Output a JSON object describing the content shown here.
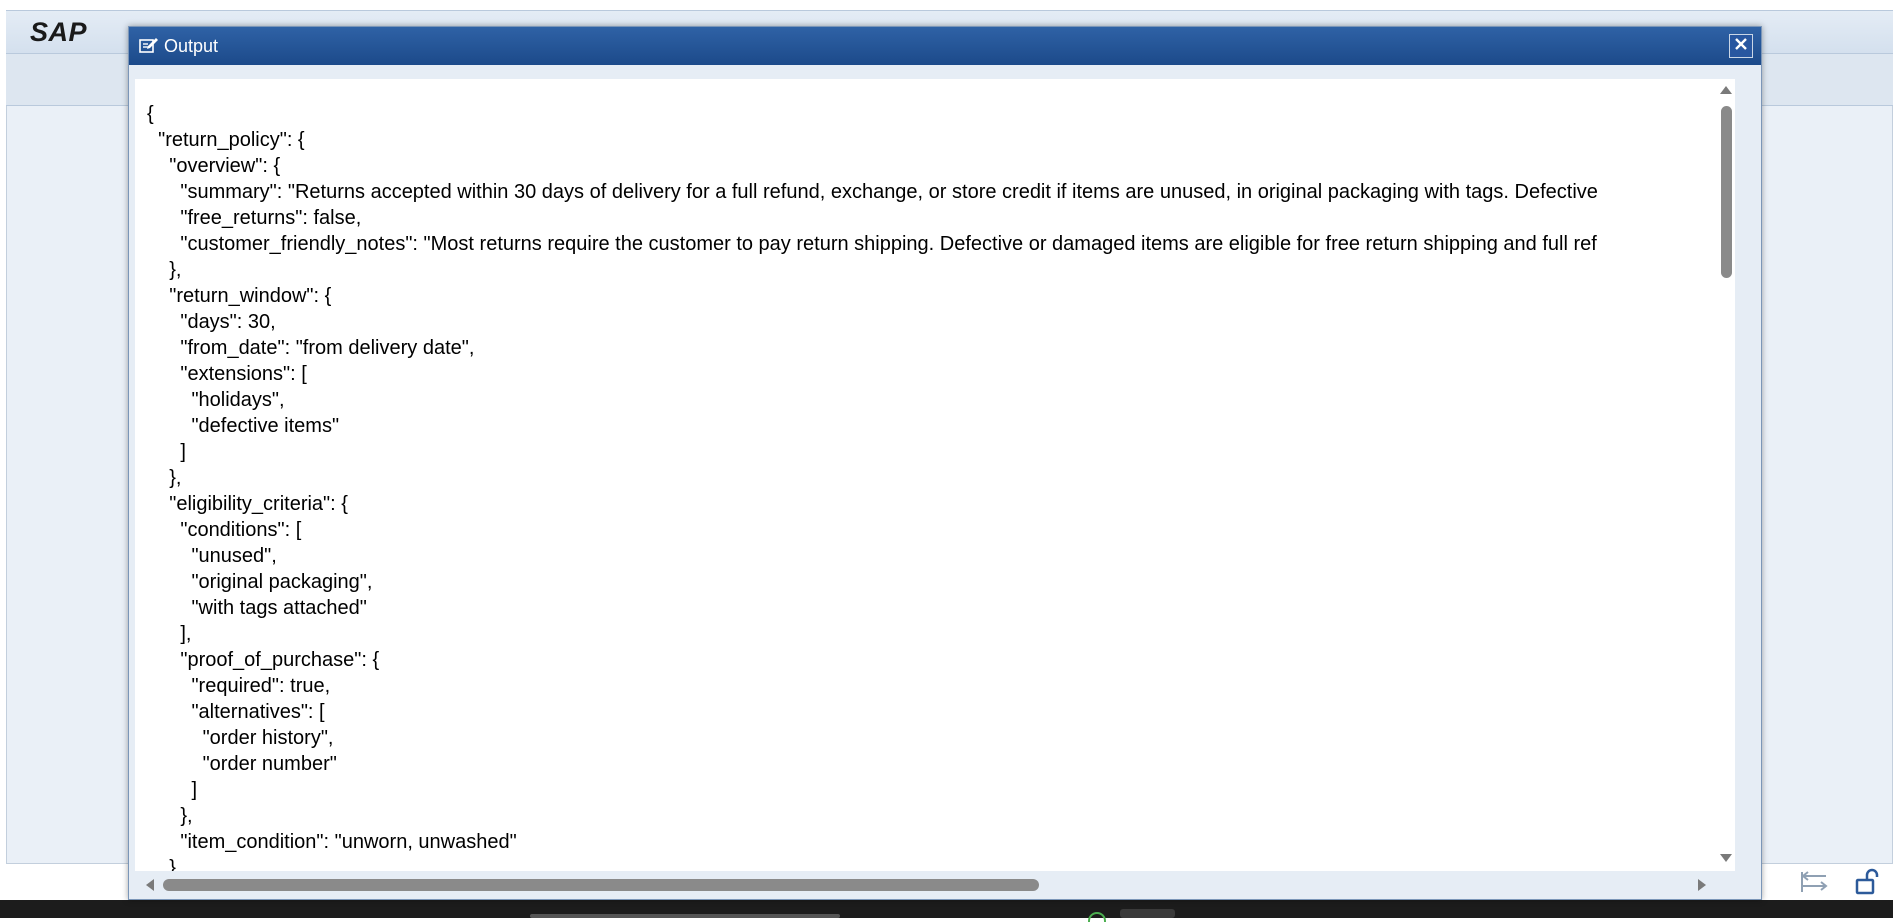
{
  "app": {
    "logo": "SAP"
  },
  "dialog": {
    "title": "Output",
    "title_icon": "output-icon",
    "close_icon": "close-icon"
  },
  "code_lines": [
    "{",
    "  \"return_policy\": {",
    "    \"overview\": {",
    "      \"summary\": \"Returns accepted within 30 days of delivery for a full refund, exchange, or store credit if items are unused, in original packaging with tags. Defective",
    "      \"free_returns\": false,",
    "      \"customer_friendly_notes\": \"Most returns require the customer to pay return shipping. Defective or damaged items are eligible for free return shipping and full ref",
    "    },",
    "    \"return_window\": {",
    "      \"days\": 30,",
    "      \"from_date\": \"from delivery date\",",
    "      \"extensions\": [",
    "        \"holidays\",",
    "        \"defective items\"",
    "      ]",
    "    },",
    "    \"eligibility_criteria\": {",
    "      \"conditions\": [",
    "        \"unused\",",
    "        \"original packaging\",",
    "        \"with tags attached\"",
    "      ],",
    "      \"proof_of_purchase\": {",
    "        \"required\": true,",
    "        \"alternatives\": [",
    "          \"order history\",",
    "          \"order number\"",
    "        ]",
    "      },",
    "      \"item_condition\": \"unworn, unwashed\"",
    "    }"
  ],
  "scrollbars": {
    "vertical_position": 0.0,
    "horizontal_position": 0.0
  },
  "status_icons": [
    "transfer-icon",
    "unlock-icon"
  ],
  "colors": {
    "titlebar": "#1c4a8a",
    "scroll_thumb": "#8a8a8a"
  }
}
